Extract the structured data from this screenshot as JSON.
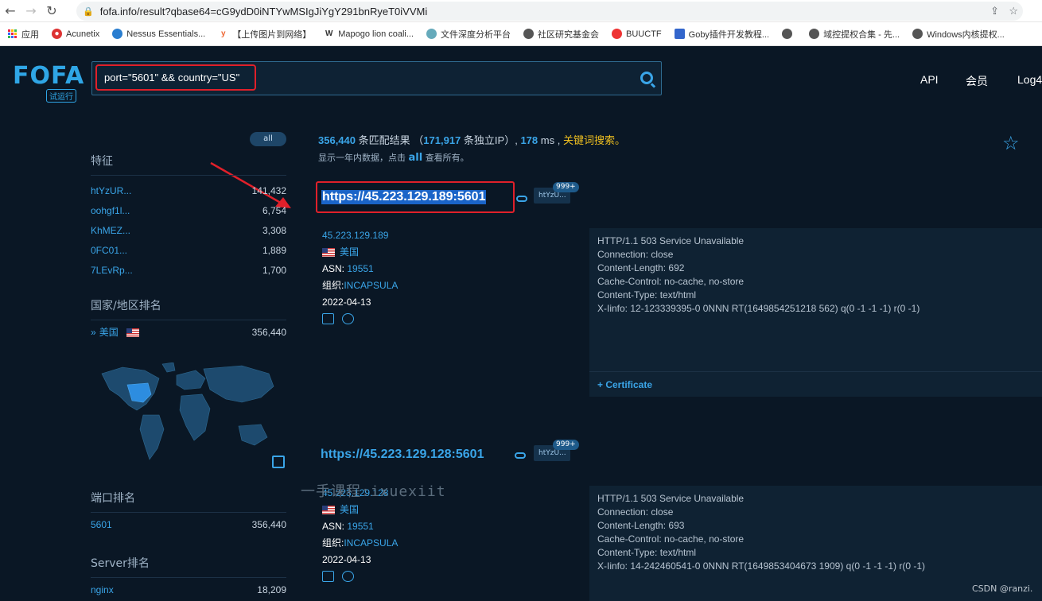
{
  "browser": {
    "url": "fofa.info/result?qbase64=cG9ydD0iNTYwMSIgJiYgY291bnRyeT0iVVMi",
    "bookmarks": [
      "应用",
      "Acunetix",
      "Nessus Essentials...",
      "【上传图片到网络】",
      "Mapogo lion coali...",
      "文件深度分析平台",
      "社区研究基金会",
      "BUUCTF",
      "Goby插件开发教程...",
      "",
      "域控提权合集 - 先...",
      "Windows内核提权..."
    ]
  },
  "header": {
    "logo": "FOFA",
    "logo_badge": "试运行",
    "query": "port=\"5601\" && country=\"US\"",
    "nav": [
      "API",
      "会员",
      "Log4"
    ]
  },
  "summary": {
    "count": "356,440",
    "count_suffix": "条匹配结果",
    "unique_ip_open": "（",
    "unique_ip": "171,917",
    "unique_ip_suffix": "条独立IP）,",
    "ms": "178",
    "ms_suffix": "ms ,",
    "keyword_search": "关键词搜索。",
    "note_prefix": "显示一年内数据，点击",
    "note_link": "all",
    "note_suffix": "查看所有。"
  },
  "sidebar": {
    "all_pill": "all",
    "features_title": "特征",
    "features": [
      {
        "k": "htYzUR...",
        "v": "141,432"
      },
      {
        "k": "oohgf1l...",
        "v": "6,754"
      },
      {
        "k": "KhMEZ...",
        "v": "3,308"
      },
      {
        "k": "0FC01...",
        "v": "1,889"
      },
      {
        "k": "7LEvRp...",
        "v": "1,700"
      }
    ],
    "country_title": "国家/地区排名",
    "country": {
      "k": "美国",
      "v": "356,440"
    },
    "port_title": "端口排名",
    "port": {
      "k": "5601",
      "v": "356,440"
    },
    "server_title": "Server排名",
    "server": {
      "k": "nginx",
      "v": "18,209"
    }
  },
  "results": [
    {
      "url": "https://45.223.129.189:5601",
      "tag": "htYzU...",
      "badge": "999+",
      "ip": "45.223.129.189",
      "country": "美国",
      "asn_label": "ASN:",
      "asn": "19551",
      "org_label": "组织:",
      "org": "INCAPSULA",
      "date": "2022-04-13",
      "banner": [
        "HTTP/1.1 503 Service Unavailable",
        "Connection: close",
        "Content-Length: 692",
        "Cache-Control: no-cache, no-store",
        "Content-Type: text/html",
        "X-Iinfo: 12-123339395-0 0NNN RT(1649854251218 562) q(0 -1 -1 -1) r(0 -1)"
      ],
      "cert": "+ Certificate"
    },
    {
      "url": "https://45.223.129.128:5601",
      "tag": "htYzU...",
      "badge": "999+",
      "ip": "45.223.129.128",
      "country": "美国",
      "asn_label": "ASN:",
      "asn": "19551",
      "org_label": "组织:",
      "org": "INCAPSULA",
      "date": "2022-04-13",
      "banner": [
        "HTTP/1.1 503 Service Unavailable",
        "Connection: close",
        "Content-Length: 693",
        "Cache-Control: no-cache, no-store",
        "Content-Type: text/html",
        "X-Iinfo: 14-242460541-0 0NNN RT(1649853404673 1909) q(0 -1 -1 -1) r(0 -1)"
      ]
    }
  ],
  "watermark": "一手课程:ixuexiit",
  "credit": "CSDN @ranzi."
}
